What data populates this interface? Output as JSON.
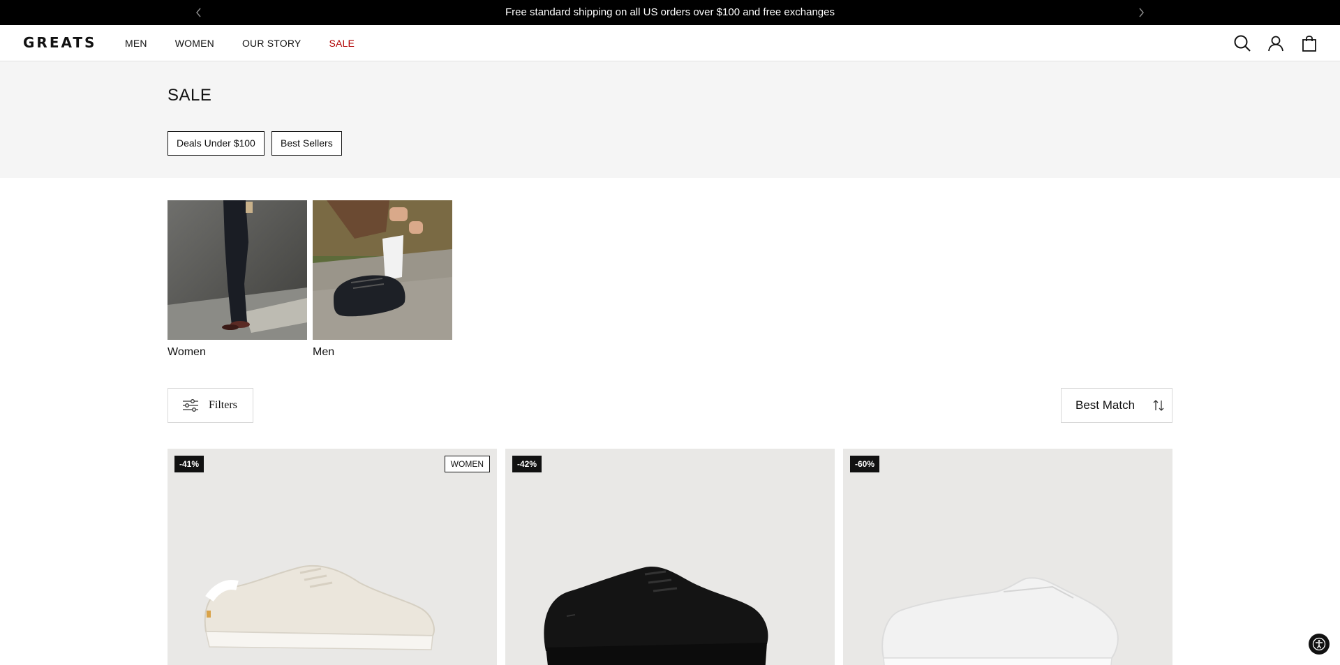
{
  "announcement": {
    "message": "Free standard shipping on all US orders over $100 and free exchanges",
    "prev_icon": "chevron-left-icon",
    "next_icon": "chevron-right-icon"
  },
  "header": {
    "logo": "GREATS",
    "nav": [
      "MEN",
      "WOMEN",
      "OUR STORY",
      "SALE"
    ],
    "sale_color": "#b00000",
    "icons": [
      "search-icon",
      "account-icon",
      "bag-icon"
    ]
  },
  "hero": {
    "title": "SALE",
    "pills": [
      "Deals Under $100",
      "Best Sellers"
    ]
  },
  "categories": [
    {
      "label": "Women"
    },
    {
      "label": "Men"
    }
  ],
  "toolbar": {
    "filters_label": "Filters",
    "sort_label": "Best Match"
  },
  "products": [
    {
      "discount": "-41%",
      "tag": "WOMEN",
      "shoe_color": "#ebe6dc"
    },
    {
      "discount": "-42%",
      "tag": "",
      "shoe_color": "#121212"
    },
    {
      "discount": "-60%",
      "tag": "",
      "shoe_color": "#f2f2f2"
    }
  ]
}
